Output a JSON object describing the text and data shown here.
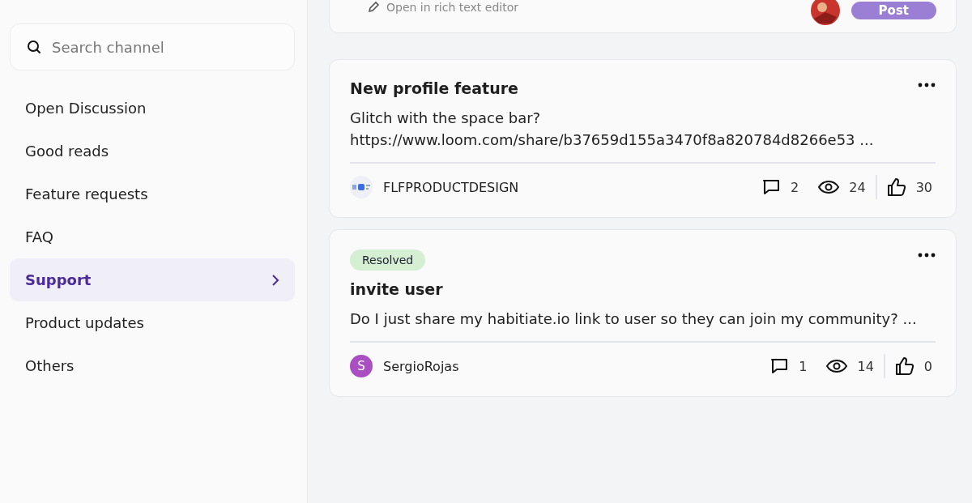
{
  "sidebar": {
    "search": {
      "placeholder": "Search channel"
    },
    "channels": [
      {
        "label": "Open Discussion",
        "selected": false
      },
      {
        "label": "Good reads",
        "selected": false
      },
      {
        "label": "Feature requests",
        "selected": false
      },
      {
        "label": "FAQ",
        "selected": false
      },
      {
        "label": "Support",
        "selected": true
      },
      {
        "label": "Product updates",
        "selected": false
      },
      {
        "label": "Others",
        "selected": false
      }
    ]
  },
  "composer": {
    "rich_text_link": "Open in rich text editor",
    "post_button": "Post"
  },
  "posts": [
    {
      "title": "New profile feature",
      "body": "Glitch with the space bar?\nhttps://www.loom.com/share/b37659d155a3470f8a820784d8266e53 ...",
      "author": {
        "name": "FLFPRODUCTDESIGN",
        "kind": "logo"
      },
      "comments": "2",
      "views": "24",
      "likes": "30"
    },
    {
      "status": "Resolved",
      "title": "invite user",
      "body": "Do I just share my habitiate.io link to user so they can join my community? ...",
      "author": {
        "name": "SergioRojas",
        "kind": "initial",
        "initial": "S",
        "color": "#a94fc2"
      },
      "comments": "1",
      "views": "14",
      "likes": "0"
    }
  ]
}
